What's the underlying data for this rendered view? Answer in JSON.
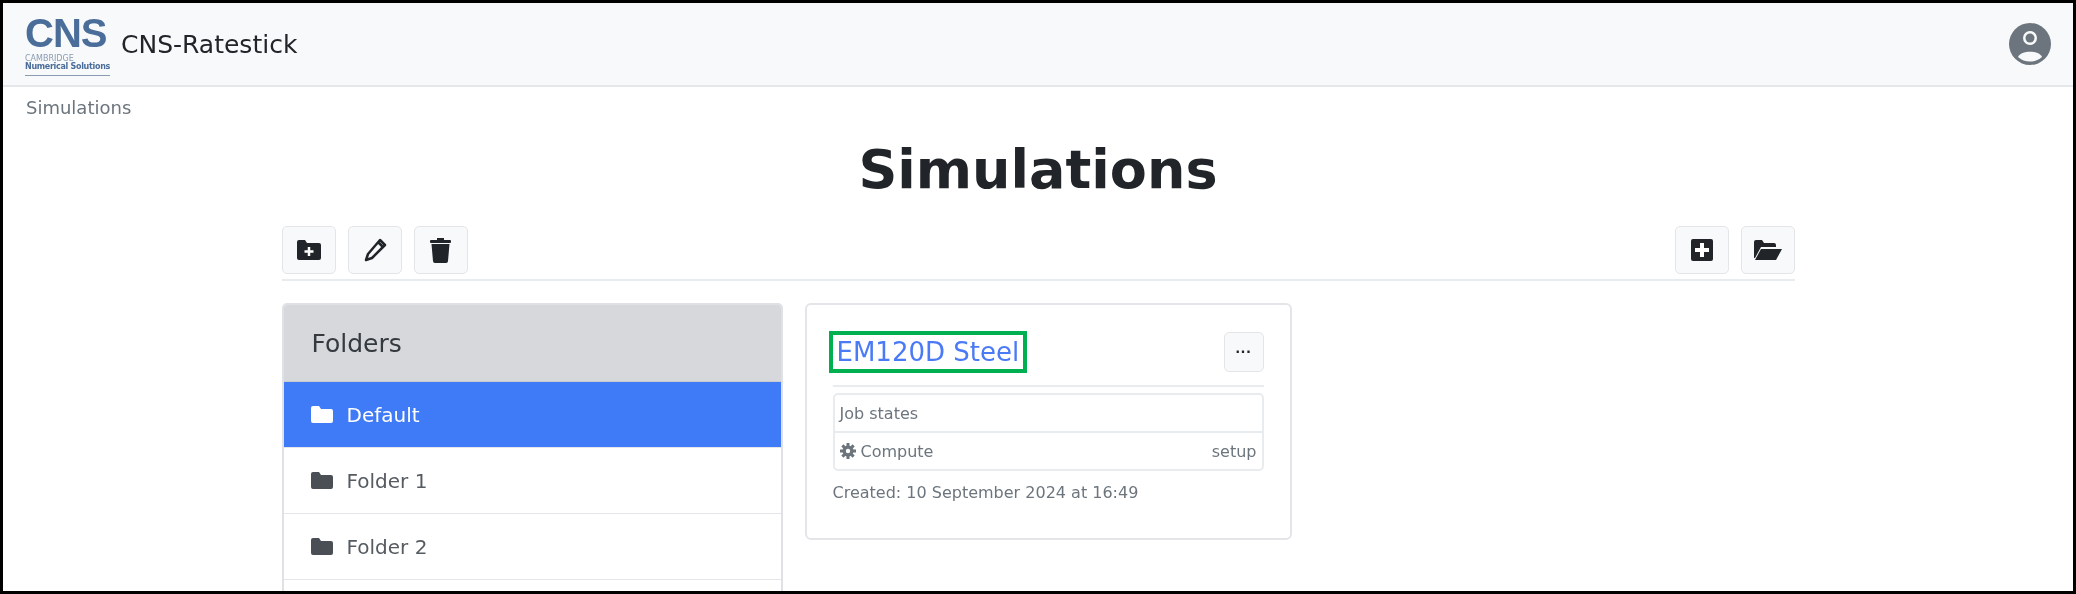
{
  "navbar": {
    "logo": {
      "mark": "CNS",
      "small_line": "CAMBRIDGE",
      "line": "Numerical Solutions"
    },
    "title": "CNS-Ratestick"
  },
  "breadcrumb": "Simulations",
  "heading": "Simulations",
  "toolbar": {
    "left": [
      {
        "kind": "folder-plus"
      },
      {
        "kind": "pencil"
      },
      {
        "kind": "trash"
      }
    ],
    "right": [
      {
        "kind": "square-plus"
      },
      {
        "kind": "folder-open"
      }
    ]
  },
  "folders": {
    "title": "Folders",
    "items": [
      {
        "label": "Default",
        "selected": true
      },
      {
        "label": "Folder 1",
        "selected": false
      },
      {
        "label": "Folder 2",
        "selected": false
      }
    ]
  },
  "simulations": [
    {
      "title": "EM120D Steel",
      "highlighted": true,
      "menu": "···",
      "job_states": {
        "title": "Job states",
        "jobs": [
          {
            "name": "Compute",
            "state": "setup"
          }
        ]
      },
      "created": "Created: 10 September 2024 at 16:49"
    }
  ]
}
